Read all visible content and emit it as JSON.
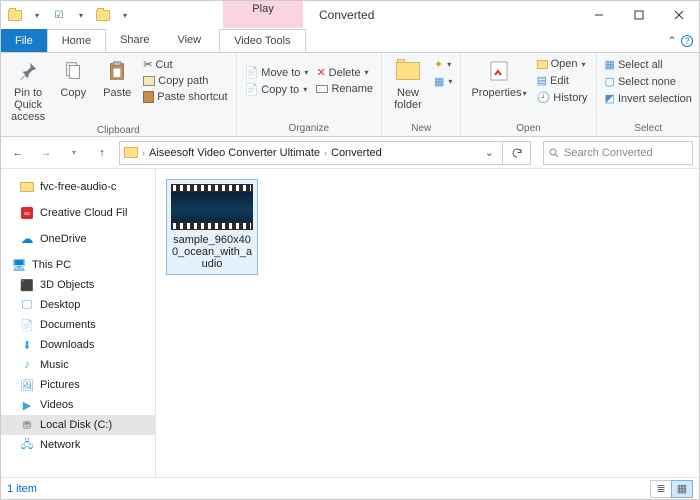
{
  "titlebar": {
    "contextual_title": "Play",
    "window_title": "Converted"
  },
  "tabs": {
    "file": "File",
    "home": "Home",
    "share": "Share",
    "view": "View",
    "video": "Video Tools"
  },
  "ribbon": {
    "pin": "Pin to Quick\naccess",
    "copy": "Copy",
    "paste": "Paste",
    "cut": "Cut",
    "copy_path": "Copy path",
    "paste_shortcut": "Paste shortcut",
    "clipboard_group": "Clipboard",
    "move_to": "Move to",
    "copy_to": "Copy to",
    "delete": "Delete",
    "rename": "Rename",
    "organize_group": "Organize",
    "new_folder": "New\nfolder",
    "new_group": "New",
    "properties": "Properties",
    "open": "Open",
    "edit": "Edit",
    "history": "History",
    "open_group": "Open",
    "select_all": "Select all",
    "select_none": "Select none",
    "invert_sel": "Invert selection",
    "select_group": "Select"
  },
  "breadcrumb": {
    "part1": "Aiseesoft Video Converter Ultimate",
    "part2": "Converted"
  },
  "search": {
    "placeholder": "Search Converted"
  },
  "nav": {
    "fvc": "fvc-free-audio-c",
    "cc": "Creative Cloud Fil",
    "onedrive": "OneDrive",
    "thispc": "This PC",
    "3dobj": "3D Objects",
    "desktop": "Desktop",
    "documents": "Documents",
    "downloads": "Downloads",
    "music": "Music",
    "pictures": "Pictures",
    "videos": "Videos",
    "localc": "Local Disk (C:)",
    "network": "Network"
  },
  "file": {
    "name": "sample_960x400_ocean_with_audio"
  },
  "status": {
    "count": "1 item"
  }
}
